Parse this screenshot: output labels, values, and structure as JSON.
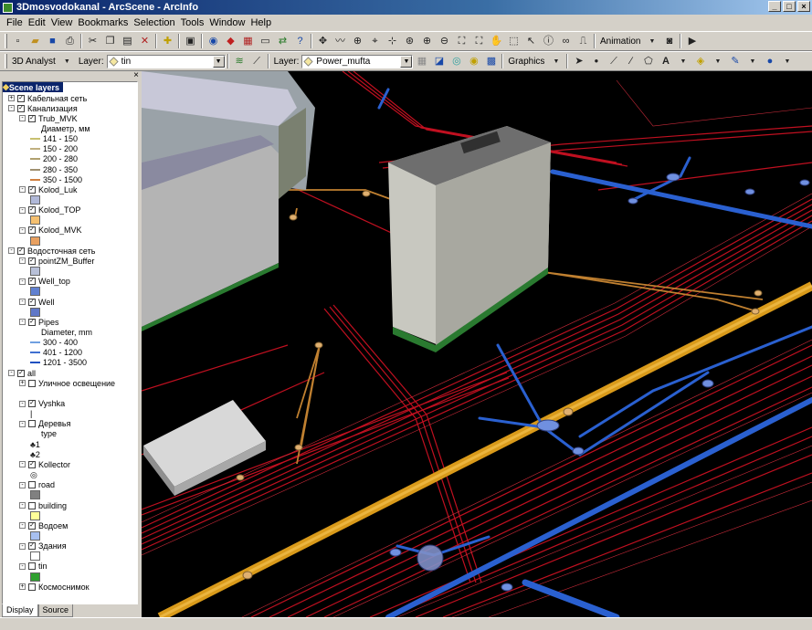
{
  "window": {
    "title": "3Dmosvodokanal - ArcScene - ArcInfo"
  },
  "menu": [
    "File",
    "Edit",
    "View",
    "Bookmarks",
    "Selection",
    "Tools",
    "Window",
    "Help"
  ],
  "toolbar1": {
    "animation_label": "Animation"
  },
  "toolbar2": {
    "analyst_label": "3D Analyst",
    "layer_label_1": "Layer:",
    "layer_value_1": "tin",
    "layer_label_2": "Layer:",
    "layer_value_2": "Power_mufta",
    "graphics_label": "Graphics"
  },
  "toc": {
    "title": "Scene layers",
    "rows": [
      {
        "indent": 0,
        "plus": "+",
        "checked": true,
        "label": "Кабельная сеть"
      },
      {
        "indent": 0,
        "plus": "−",
        "checked": true,
        "label": "Канализация"
      },
      {
        "indent": 1,
        "plus": "−",
        "checked": true,
        "label": "Trub_MVK"
      },
      {
        "indent": 3,
        "label": "Диаметр, мм"
      },
      {
        "indent": 2,
        "line": "#c8c070",
        "label": "141 - 150"
      },
      {
        "indent": 2,
        "line": "#c0b080",
        "label": "150 - 200"
      },
      {
        "indent": 2,
        "line": "#b0a070",
        "label": "200 - 280"
      },
      {
        "indent": 2,
        "line": "#a09070",
        "label": "280 - 350"
      },
      {
        "indent": 2,
        "line": "#d08040",
        "label": "350 - 1500"
      },
      {
        "indent": 1,
        "plus": "−",
        "checked": true,
        "label": "Kolod_Luk"
      },
      {
        "indent": 2,
        "swatch": "#b0b8d8"
      },
      {
        "indent": 1,
        "plus": "−",
        "checked": true,
        "label": "Kolod_TOP"
      },
      {
        "indent": 2,
        "swatch": "#f5c070"
      },
      {
        "indent": 1,
        "plus": "−",
        "checked": true,
        "label": "Kolod_MVK"
      },
      {
        "indent": 2,
        "swatch": "#e8a060"
      },
      {
        "indent": 0,
        "plus": "−",
        "checked": true,
        "label": "Водосточная сеть"
      },
      {
        "indent": 1,
        "plus": "−",
        "checked": true,
        "label": "pointZM_Buffer"
      },
      {
        "indent": 2,
        "swatch": "#b8c0d8"
      },
      {
        "indent": 1,
        "plus": "−",
        "checked": true,
        "label": "Well_top"
      },
      {
        "indent": 2,
        "swatch": "#6080d0"
      },
      {
        "indent": 1,
        "plus": "−",
        "checked": true,
        "label": "Well"
      },
      {
        "indent": 2,
        "swatch": "#6078c8"
      },
      {
        "indent": 1,
        "plus": "−",
        "checked": true,
        "label": "Pipes"
      },
      {
        "indent": 3,
        "label": "Diameter, mm"
      },
      {
        "indent": 2,
        "line": "#70a0e0",
        "label": "300 - 400"
      },
      {
        "indent": 2,
        "line": "#4070d0",
        "label": "401 - 1200"
      },
      {
        "indent": 2,
        "line": "#2050c0",
        "label": "1201 - 3500"
      },
      {
        "indent": 0,
        "plus": "−",
        "checked": true,
        "label": "all"
      },
      {
        "indent": 1,
        "plus": "+",
        "checked": false,
        "label": "Уличное освещение"
      },
      {
        "indent": 1,
        "label": ""
      },
      {
        "indent": 1,
        "plus": "−",
        "checked": true,
        "label": "Vyshka"
      },
      {
        "indent": 2,
        "label": "|"
      },
      {
        "indent": 1,
        "plus": "−",
        "checked": false,
        "label": "Деревья"
      },
      {
        "indent": 3,
        "label": "type"
      },
      {
        "indent": 2,
        "icon": "tree",
        "label": "1"
      },
      {
        "indent": 2,
        "icon": "tree",
        "label": "2"
      },
      {
        "indent": 1,
        "plus": "−",
        "checked": true,
        "label": "Kollector"
      },
      {
        "indent": 2,
        "label": "◎"
      },
      {
        "indent": 1,
        "plus": "−",
        "checked": false,
        "label": "road"
      },
      {
        "indent": 2,
        "swatch": "#808080"
      },
      {
        "indent": 1,
        "plus": "−",
        "checked": false,
        "label": "building"
      },
      {
        "indent": 2,
        "swatch": "#ffff99"
      },
      {
        "indent": 1,
        "plus": "−",
        "checked": true,
        "label": "Водоем"
      },
      {
        "indent": 2,
        "swatch": "#a8c0f0"
      },
      {
        "indent": 1,
        "plus": "−",
        "checked": true,
        "label": "Здания"
      },
      {
        "indent": 2,
        "swatch": "#ffffff"
      },
      {
        "indent": 1,
        "plus": "−",
        "checked": false,
        "label": "tin"
      },
      {
        "indent": 2,
        "swatch": "#30a030"
      },
      {
        "indent": 1,
        "plus": "+",
        "checked": false,
        "label": "Космоснимок"
      }
    ],
    "tabs": [
      "Display",
      "Source"
    ]
  }
}
